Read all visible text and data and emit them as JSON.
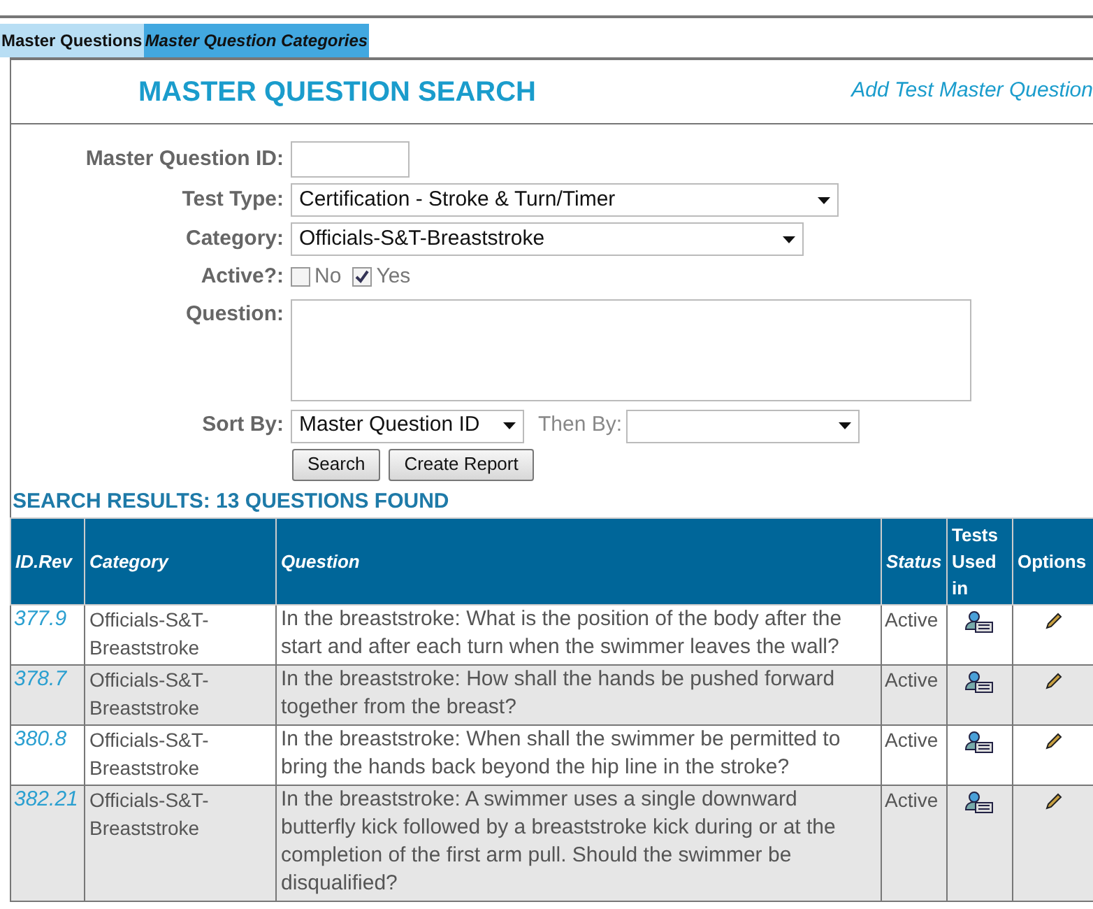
{
  "tabs": [
    {
      "label": "Master Questions",
      "selected": false
    },
    {
      "label": "Master Question Categories",
      "selected": true
    }
  ],
  "header": {
    "title": "MASTER QUESTION SEARCH",
    "link": "Add Test Master Question"
  },
  "form": {
    "master_question_id": {
      "label": "Master Question ID:"
    },
    "test_type": {
      "label": "Test Type:",
      "value": "Certification - Stroke & Turn/Timer"
    },
    "category": {
      "label": "Category:",
      "value": "Officials-S&T-Breaststroke"
    },
    "active": {
      "label": "Active?:",
      "options": [
        {
          "label": "No",
          "checked": false
        },
        {
          "label": "Yes",
          "checked": true
        }
      ]
    },
    "question": {
      "label": "Question:"
    },
    "sort_by": {
      "label": "Sort By:",
      "value": "Master Question ID"
    },
    "then_by": {
      "label": "Then By:"
    },
    "buttons": [
      "Search",
      "Create Report"
    ]
  },
  "results": {
    "title": "SEARCH RESULTS: 13 QUESTIONS FOUND",
    "columns": [
      "ID.Rev",
      "Category",
      "Question",
      "Status",
      "Tests Used in",
      "Options"
    ],
    "rows": [
      {
        "id": "377.9",
        "category": "Officials-S&T-Breaststroke",
        "question": "In the breaststroke: What is the position of the body after the start and after each turn when the swimmer leaves the wall?",
        "status": "Active"
      },
      {
        "id": "378.7",
        "category": "Officials-S&T-Breaststroke",
        "question": "In the breaststroke: How shall the hands be pushed forward together from the breast?",
        "status": "Active"
      },
      {
        "id": "380.8",
        "category": "Officials-S&T-Breaststroke",
        "question": "In the breaststroke: When shall the swimmer be permitted to bring the hands back beyond the hip line in the stroke?",
        "status": "Active"
      },
      {
        "id": "382.21",
        "category": "Officials-S&T-Breaststroke",
        "question": "In the breaststroke: A swimmer uses a single downward butterfly kick followed by a breaststroke kick during or at the completion of the first arm pull. Should the swimmer be disqualified?",
        "status": "Active"
      }
    ]
  }
}
